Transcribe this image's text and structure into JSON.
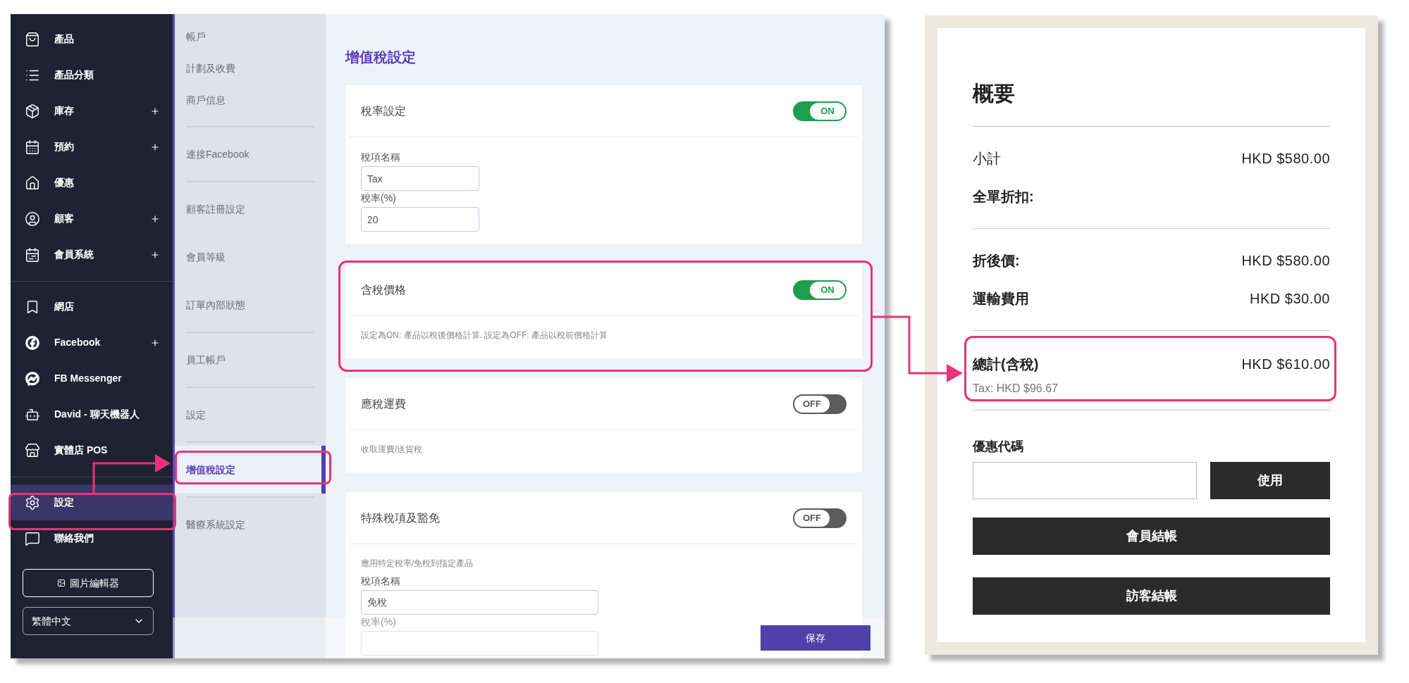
{
  "sidebar": {
    "groups": [
      [
        {
          "label": "產品",
          "expandable": false,
          "selected": false
        },
        {
          "label": "產品分類",
          "expandable": false,
          "selected": false
        },
        {
          "label": "庫存",
          "expandable": true,
          "selected": false
        },
        {
          "label": "預約",
          "expandable": true,
          "selected": false
        },
        {
          "label": "優惠",
          "expandable": false,
          "selected": false
        },
        {
          "label": "顧客",
          "expandable": true,
          "selected": false
        },
        {
          "label": "會員系統",
          "expandable": true,
          "selected": false
        }
      ],
      [
        {
          "label": "網店",
          "expandable": false,
          "selected": false
        },
        {
          "label": "Facebook",
          "expandable": true,
          "selected": false
        },
        {
          "label": "FB Messenger",
          "expandable": false,
          "selected": false
        },
        {
          "label": "David - 聊天機器人",
          "expandable": false,
          "selected": false
        },
        {
          "label": "實體店 POS",
          "expandable": false,
          "selected": false
        }
      ],
      [
        {
          "label": "設定",
          "expandable": false,
          "selected": true
        },
        {
          "label": "聯絡我們",
          "expandable": false,
          "selected": false
        }
      ]
    ],
    "image_editor_button": "圖片編輯器",
    "language": "繁體中文"
  },
  "settings_nav": {
    "groups": [
      [
        {
          "label": "帳戶",
          "selected": false
        },
        {
          "label": "計劃及收費",
          "selected": false
        },
        {
          "label": "商戶信息",
          "selected": false
        }
      ],
      [
        {
          "label": "連接Facebook",
          "selected": false
        }
      ],
      [
        {
          "label": "顧客註冊設定",
          "selected": false
        },
        {
          "label": "會員等級",
          "selected": false
        },
        {
          "label": "訂單內部狀態",
          "selected": false
        }
      ],
      [
        {
          "label": "員工帳戶",
          "selected": false
        }
      ],
      [
        {
          "label": "設定",
          "selected": false
        }
      ],
      [
        {
          "label": "增值稅設定",
          "selected": true
        }
      ],
      [
        {
          "label": "醫療系統設定",
          "selected": false
        }
      ]
    ]
  },
  "main": {
    "title": "增值稅設定",
    "sections": [
      {
        "title": "稅率設定",
        "on": true,
        "toggle_label": "ON",
        "fields": [
          {
            "label": "稅項名稱",
            "value": "Tax"
          },
          {
            "label": "稅率(%)",
            "value": "20"
          }
        ]
      },
      {
        "title": "含稅價格",
        "on": true,
        "toggle_label": "ON",
        "description": "設定為ON: 產品以稅後價格計算. 設定為OFF: 產品以稅前價格計算"
      },
      {
        "title": "應稅運費",
        "on": false,
        "toggle_label": "OFF",
        "description": "收取運費/送貨稅"
      },
      {
        "title": "特殊稅項及豁免",
        "on": false,
        "toggle_label": "OFF",
        "description": "應用特定稅率/免稅到指定產品",
        "fields": [
          {
            "label": "稅項名稱",
            "value": "免稅"
          },
          {
            "label": "稅率(%)"
          }
        ]
      }
    ],
    "save_button": "保存"
  },
  "summary": {
    "title": "概要",
    "groups": [
      [
        {
          "label": "小計",
          "value": "HKD $580.00"
        },
        {
          "label": "全單折扣:"
        }
      ],
      [
        {
          "label": "折後價:",
          "value": "HKD $580.00"
        },
        {
          "label": "運輸費用",
          "value": "HKD $30.00"
        }
      ]
    ],
    "total": {
      "label": "總計(含稅)",
      "value": "HKD $610.00",
      "note": "Tax: HKD $96.67"
    },
    "coupon": {
      "label": "優惠代碼",
      "apply_button": "使用"
    },
    "buttons": [
      "會員結帳",
      "訪客結帳"
    ]
  }
}
